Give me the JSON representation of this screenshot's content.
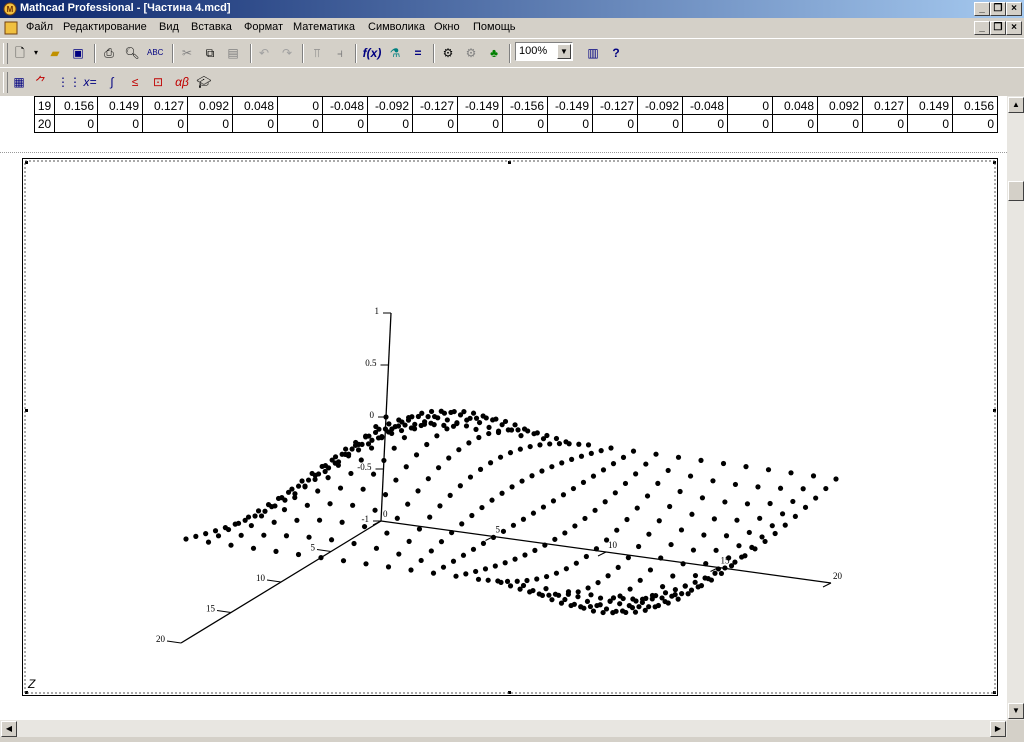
{
  "window": {
    "title": "Mathcad Professional - [Частина 4.mcd]",
    "controls": [
      "_",
      "▭",
      "×"
    ]
  },
  "menu": [
    "Файл",
    "Редактирование",
    "Вид",
    "Вставка",
    "Формат",
    "Математика",
    "Символика",
    "Окно",
    "Помощь"
  ],
  "toolbar": {
    "zoom": "100%"
  },
  "matrix": {
    "rows": [
      {
        "index": "19",
        "values": [
          "0.156",
          "0.149",
          "0.127",
          "0.092",
          "0.048",
          "0",
          "-0.048",
          "-0.092",
          "-0.127",
          "-0.149",
          "-0.156",
          "-0.149",
          "-0.127",
          "-0.092",
          "-0.048",
          "0",
          "0.048",
          "0.092",
          "0.127",
          "0.149",
          "0.156"
        ]
      },
      {
        "index": "20",
        "values": [
          "0",
          "0",
          "0",
          "0",
          "0",
          "0",
          "0",
          "0",
          "0",
          "0",
          "0",
          "0",
          "0",
          "0",
          "0",
          "0",
          "0",
          "0",
          "0",
          "0",
          "0"
        ]
      }
    ]
  },
  "plot": {
    "surface_label": "Z",
    "z_ticks": [
      "1",
      "0.5",
      "0",
      "-0.5",
      "-1"
    ],
    "x_ticks": [
      "0",
      "5",
      "10",
      "15",
      "20"
    ],
    "y_ticks": [
      "5",
      "10",
      "15",
      "20"
    ]
  },
  "chart_data": {
    "type": "scatter",
    "title": "",
    "series": [
      {
        "values": "Z(i,j) = sin-like surface over 21x21 grid"
      }
    ],
    "x": [
      0,
      5,
      10,
      15,
      20
    ],
    "ylim": [
      -1,
      1
    ],
    "zlabel": "Z"
  }
}
